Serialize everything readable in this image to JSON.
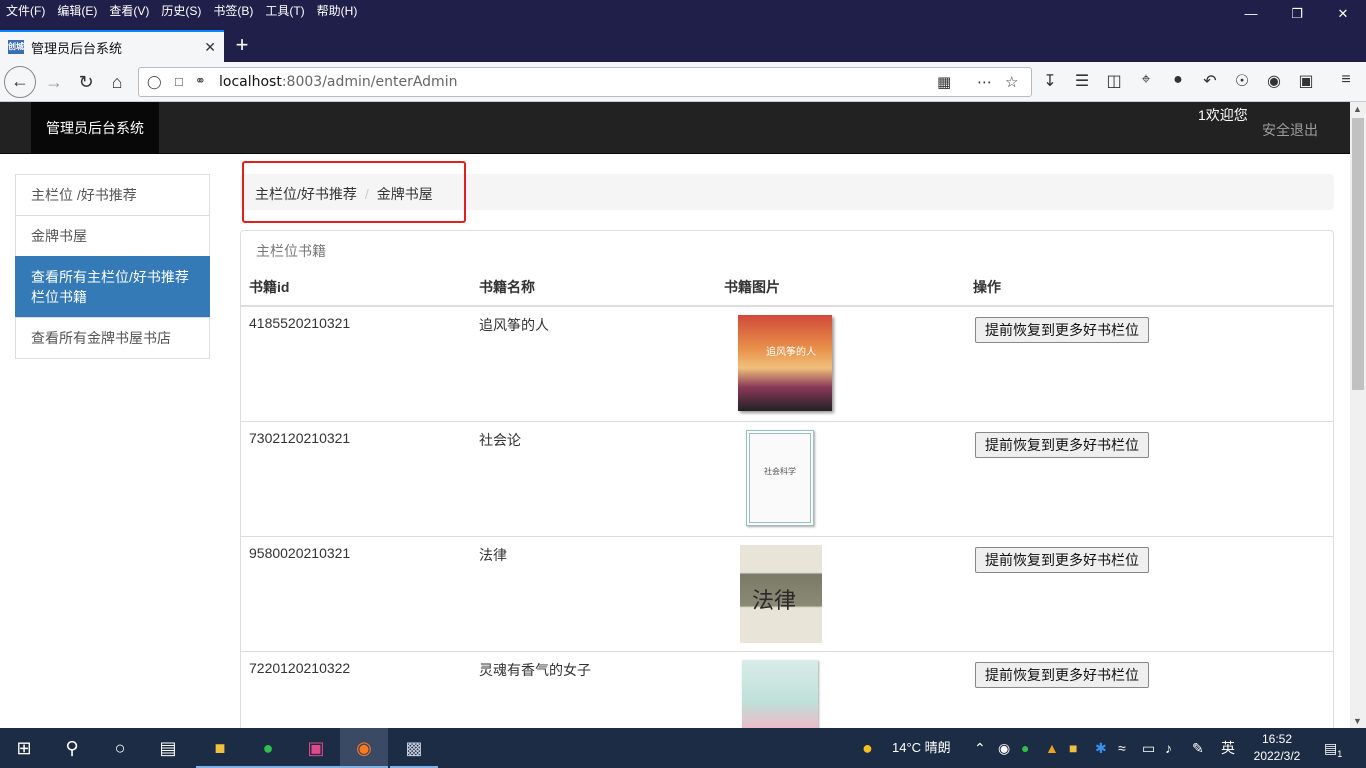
{
  "browser": {
    "menus": [
      "文件(F)",
      "编辑(E)",
      "查看(V)",
      "历史(S)",
      "书签(B)",
      "工具(T)",
      "帮助(H)"
    ],
    "tab_title": "管理员后台系统",
    "favicon_text": "创城",
    "url_host": "localhost",
    "url_path": ":8003/admin/enterAdmin"
  },
  "header": {
    "brand": "管理员后台系统",
    "welcome": "1欢迎您",
    "logout": "安全退出"
  },
  "sidebar": {
    "items": [
      {
        "label": "主栏位 /好书推荐"
      },
      {
        "label": "金牌书屋"
      },
      {
        "label": "查看所有主栏位/好书推荐栏位书籍"
      },
      {
        "label": "查看所有金牌书屋书店"
      }
    ]
  },
  "breadcrumb": {
    "items": [
      "主栏位/好书推荐",
      "金牌书屋"
    ],
    "separator": "/"
  },
  "panel": {
    "title": "主栏位书籍",
    "columns": [
      "书籍id",
      "书籍名称",
      "书籍图片",
      "操作"
    ],
    "rows": [
      {
        "id": "4185520210321",
        "name": "追风筝的人",
        "cover_text": "追风筝的人",
        "action": "提前恢复到更多好书栏位"
      },
      {
        "id": "7302120210321",
        "name": "社会论",
        "cover_text": "社会科学",
        "action": "提前恢复到更多好书栏位"
      },
      {
        "id": "9580020210321",
        "name": "法律",
        "cover_text": "法律",
        "action": "提前恢复到更多好书栏位"
      },
      {
        "id": "7220120210322",
        "name": "灵魂有香气的女子",
        "cover_text": "",
        "action": "提前恢复到更多好书栏位"
      }
    ]
  },
  "taskbar": {
    "weather": "14°C 晴朗",
    "ime": "英",
    "time": "16:52",
    "date": "2022/3/2",
    "notification_count": "1"
  },
  "colors": {
    "titlebar": "#1f1f4a",
    "app_header": "#222222",
    "active_sidebar": "#337ab7",
    "highlight_box": "#e02020",
    "taskbar": "#1c2c44"
  }
}
